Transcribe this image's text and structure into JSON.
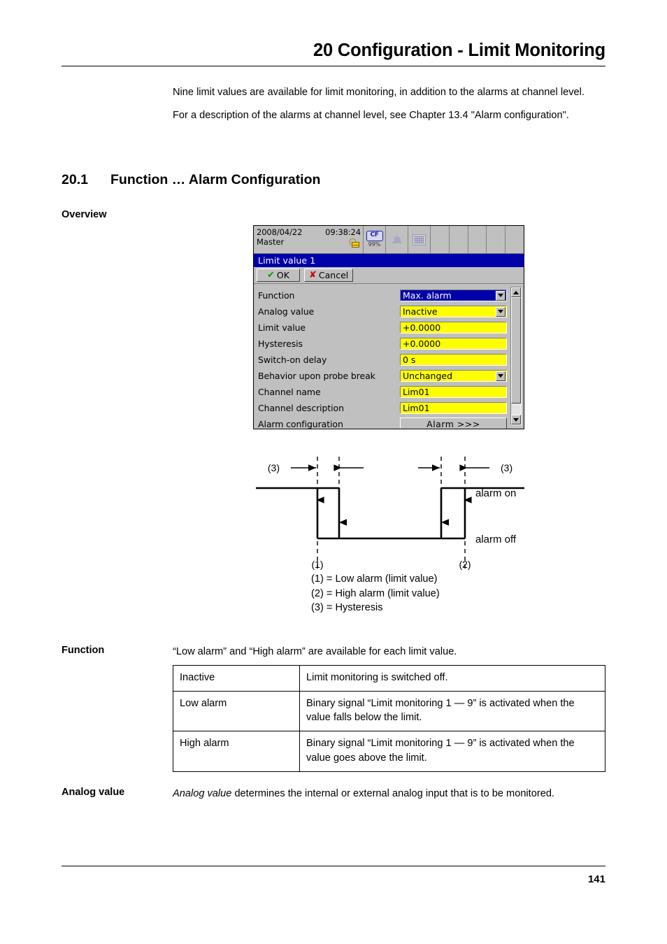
{
  "header": {
    "chapter_title": "20 Configuration - Limit Monitoring"
  },
  "intro": {
    "paragraph_1": "Nine limit values are available for limit monitoring, in addition to the alarms at channel level.",
    "paragraph_2": "For a description of the alarms at channel level, see Chapter 13.4 \"Alarm configuration\"."
  },
  "section": {
    "number": "20.1",
    "title": "Function … Alarm Configuration",
    "overview_label": "Overview"
  },
  "device": {
    "status": {
      "date": "2008/04/22",
      "time": "09:38:24",
      "user": "Master",
      "padlock_icon": "padlock-unlocked-icon",
      "cf_label": "CF",
      "cf_percent": "99%",
      "bell_icon": "bell-icon",
      "display_icon": "display-icon"
    },
    "window_title": "Limit value 1",
    "buttons": {
      "ok": "OK",
      "cancel": "Cancel"
    },
    "fields": [
      {
        "label": "Function",
        "value": "Max. alarm",
        "type": "combo",
        "selected": true
      },
      {
        "label": "Analog value",
        "value": "Inactive",
        "type": "combo",
        "selected": false
      },
      {
        "label": "Limit value",
        "value": "+0.0000",
        "type": "text",
        "selected": false
      },
      {
        "label": "Hysteresis",
        "value": "+0.0000",
        "type": "text",
        "selected": false
      },
      {
        "label": "Switch-on delay",
        "value": "0 s",
        "type": "text",
        "selected": false
      },
      {
        "label": "Behavior upon probe break",
        "value": "Unchanged",
        "type": "combo",
        "selected": false
      },
      {
        "label": "Channel name",
        "value": "Lim01",
        "type": "text",
        "selected": false
      },
      {
        "label": "Channel description",
        "value": "Lim01",
        "type": "text",
        "selected": false
      },
      {
        "label": "Alarm configuration",
        "value": "Alarm >>>",
        "type": "button",
        "selected": false
      }
    ],
    "colors": {
      "title_bar": "#0000aa",
      "field_background": "#ffff00",
      "window_background": "#c0c0c0"
    }
  },
  "diagram": {
    "marker_hysteresis_left": "(3)",
    "marker_hysteresis_right": "(3)",
    "marker_low": "(1)",
    "marker_high": "(2)",
    "alarm_on_label": "alarm on",
    "alarm_off_label": "alarm off",
    "legend": [
      "(1) = Low alarm (limit value)",
      "(2) = High alarm (limit value)",
      "(3) = Hysteresis"
    ]
  },
  "function_block": {
    "label": "Function",
    "intro": "“Low alarm” and “High alarm” are available for each limit value.",
    "rows": [
      {
        "name": "Inactive",
        "description": "Limit monitoring is switched off."
      },
      {
        "name": "Low alarm",
        "description": "Binary signal “Limit monitoring 1 — 9” is activated when the value falls below the limit."
      },
      {
        "name": "High alarm",
        "description": "Binary signal “Limit monitoring 1 — 9” is activated when the value goes above the limit."
      }
    ]
  },
  "analog_block": {
    "label": "Analog value",
    "text_italic": "Analog value",
    "text_rest": " determines the internal or external analog input that is to be monitored."
  },
  "footer": {
    "page_number": "141"
  }
}
